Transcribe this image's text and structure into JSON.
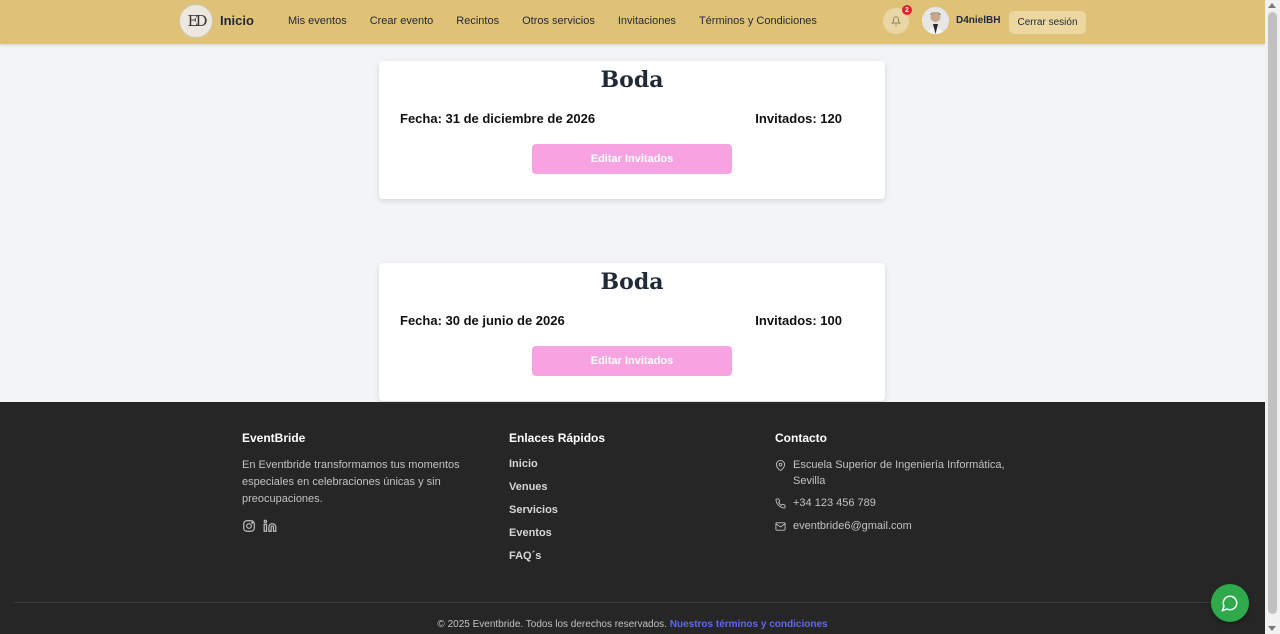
{
  "navbar": {
    "logo_text": "ED",
    "brand": "Inicio",
    "links": [
      "Mis eventos",
      "Crear evento",
      "Recintos",
      "Otros servicios",
      "Invitaciones",
      "Términos y Condiciones"
    ],
    "notification_count": "2",
    "username": "D4nielBH",
    "logout_label": "Cerrar sesión"
  },
  "events": [
    {
      "title": "Boda",
      "date": "Fecha: 31 de diciembre de 2026",
      "guests": "Invitados: 120",
      "button": "Editar Invitados"
    },
    {
      "title": "Boda",
      "date": "Fecha: 30 de junio de 2026",
      "guests": "Invitados: 100",
      "button": "Editar Invitados"
    }
  ],
  "footer": {
    "brand_title": "EventBride",
    "description": "En Eventbride transformamos tus momentos especiales en celebraciones únicas y sin preocupaciones.",
    "quick_links_title": "Enlaces Rápidos",
    "quick_links": [
      "Inicio",
      "Venues",
      "Servicios",
      "Eventos",
      "FAQ´s"
    ],
    "contact_title": "Contacto",
    "address": "Escuela Superior de Ingeniería Informática, Sevilla",
    "phone": "+34 123 456 789",
    "email": "eventbride6@gmail.com",
    "copyright": "© 2025 Eventbride. Todos los derechos reservados.",
    "terms_link": "Nuestros términos y condiciones"
  },
  "colors": {
    "navbar_bg": "#e0c178",
    "edit_button": "#f7a3e2",
    "footer_bg": "#262626",
    "chat_button": "#2eaa4b",
    "link_accent": "#6366f1"
  },
  "icons": [
    "logo-icon",
    "bell-icon",
    "avatar",
    "instagram-icon",
    "linkedin-icon",
    "location-icon",
    "phone-icon",
    "mail-icon",
    "chat-icon"
  ]
}
